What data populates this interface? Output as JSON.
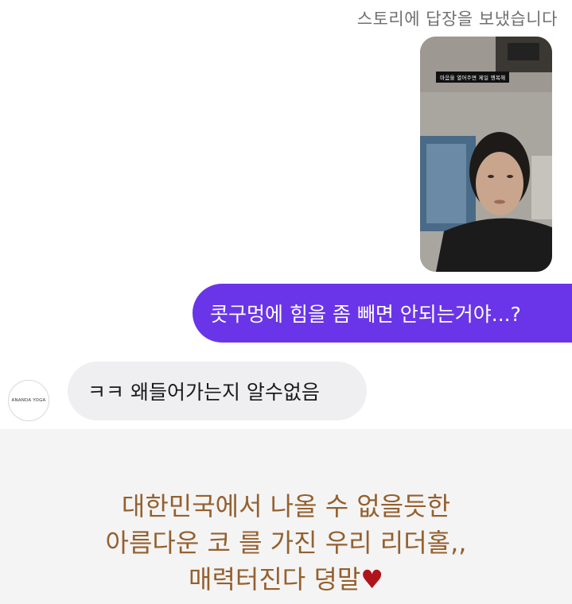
{
  "story_reply": {
    "header": "스토리에 답장을 보냈습니다",
    "thumbnail_caption": "마음을 열어주면 제일 행복해"
  },
  "messages": {
    "sent": "콧구멍에 힘을 좀 빼면 안되는거야...?",
    "received": "ㅋㅋ 왜들어가는지 알수없음",
    "avatar_label": "ANANDA YOGA"
  },
  "bottom_caption": {
    "line1": "대한민국에서 나올 수 없을듯한",
    "line2": "아름다운 코 를 가진 우리  리더홀,,",
    "line3": "매력터진다 뎡말",
    "heart_glyph": "♥"
  },
  "colors": {
    "sent_bubble": "#6a35e8",
    "received_bubble": "#efeff1",
    "caption_text": "#95602e",
    "heart": "#b0141b"
  }
}
